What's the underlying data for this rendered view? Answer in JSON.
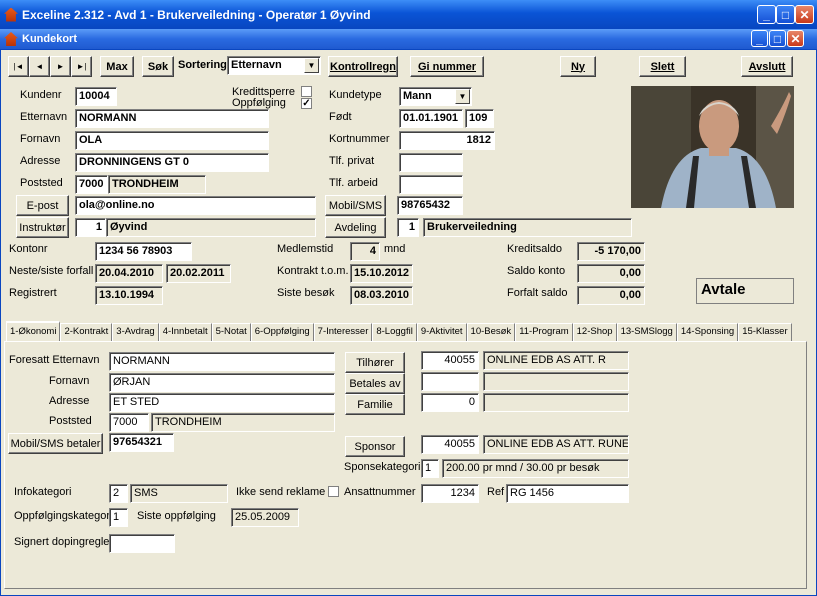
{
  "app": {
    "title": "Exceline 2.312 - Avd 1 - Brukerveiledning - Operatør 1 Øyvind"
  },
  "child": {
    "title": "Kundekort"
  },
  "toolbar": {
    "first": "|◄",
    "prev": "◄",
    "next": "►",
    "last": "►|",
    "max": "Max",
    "search": "Søk",
    "sort_label": "Sortering",
    "sort_value": "Etternavn",
    "kontrollregn": "Kontrollregn",
    "gi_nummer": "Gi nummer",
    "ny": "Ny",
    "slett": "Slett",
    "avslutt": "Avslutt"
  },
  "customer": {
    "kundenr_label": "Kundenr",
    "kundenr": "10004",
    "kredittsperre_label": "Kredittsperre",
    "oppfolging_label": "Oppfølging",
    "kundetype_label": "Kundetype",
    "kundetype": "Mann",
    "etternavn_label": "Etternavn",
    "etternavn": "NORMANN",
    "fodt_label": "Født",
    "fodt": "01.01.1901",
    "alder": "109",
    "fornavn_label": "Fornavn",
    "fornavn": "OLA",
    "kortnummer_label": "Kortnummer",
    "kortnummer": "1812",
    "adresse_label": "Adresse",
    "adresse": "DRONNINGENS GT 0",
    "tlf_privat_label": "Tlf. privat",
    "tlf_privat": "",
    "poststed_label": "Poststed",
    "postnr": "7000",
    "poststed": "TRONDHEIM",
    "tlf_arbeid_label": "Tlf. arbeid",
    "tlf_arbeid": "",
    "epost_btn": "E-post",
    "epost": "ola@online.no",
    "mobil_btn": "Mobil/SMS",
    "mobil": "98765432",
    "instruktor_btn": "Instruktør",
    "instruktor_nr": "1",
    "instruktor": "Øyvind",
    "avdeling_btn": "Avdeling",
    "avdeling_nr": "1",
    "avdeling": "Brukerveiledning"
  },
  "account": {
    "kontonr_label": "Kontonr",
    "kontonr": "1234 56 78903",
    "medlemstid_label": "Medlemstid",
    "medlemstid": "4",
    "mnd": "mnd",
    "kreditsaldo_label": "Kreditsaldo",
    "kreditsaldo": "-5 170,00",
    "forfall_label": "Neste/siste forfall",
    "neste_forfall": "20.04.2010",
    "siste_forfall": "20.02.2011",
    "kontrakt_label": "Kontrakt t.o.m.",
    "kontrakt": "15.10.2012",
    "saldo_label": "Saldo konto",
    "saldo": "0,00",
    "registrert_label": "Registrert",
    "registrert": "13.10.1994",
    "besok_label": "Siste besøk",
    "besok": "08.03.2010",
    "forfalt_label": "Forfalt saldo",
    "forfalt": "0,00",
    "avtale": "Avtale"
  },
  "tabs": [
    "1-Økonomi",
    "2-Kontrakt",
    "3-Avdrag",
    "4-Innbetalt",
    "5-Notat",
    "6-Oppfølging",
    "7-Interesser",
    "8-Loggfil",
    "9-Aktivitet",
    "10-Besøk",
    "11-Program",
    "12-Shop",
    "13-SMSlogg",
    "14-Sponsing",
    "15-Klasser"
  ],
  "economy": {
    "foresatt_label": "Foresatt Etternavn",
    "foresatt_etternavn": "NORMANN",
    "fornavn_label": "Fornavn",
    "fornavn": "ØRJAN",
    "adresse_label": "Adresse",
    "adresse": "ET STED",
    "poststed_label": "Poststed",
    "postnr": "7000",
    "poststed": "TRONDHEIM",
    "mobil_btn": "Mobil/SMS betaler",
    "mobil": "97654321",
    "tilhorer_btn": "Tilhører",
    "tilhorer_nr": "40055",
    "tilhorer": "ONLINE EDB AS ATT. R",
    "betales_btn": "Betales av",
    "betales_nr": "",
    "betales": "",
    "familie_btn": "Familie",
    "familie_nr": "0",
    "familie": "",
    "sponsor_btn": "Sponsor",
    "sponsor_nr": "40055",
    "sponsor": "ONLINE EDB AS ATT. RUNE",
    "sponsekategori_label": "Sponsekategori",
    "sponsekategori_nr": "1",
    "sponsekategori": "200.00 pr mnd / 30.00 pr besøk",
    "infokategori_label": "Infokategori",
    "infokategori_nr": "2",
    "infokategori": "SMS",
    "reklame_label": "Ikke send reklame",
    "ansattnr_label": "Ansattnummer",
    "ansattnr": "1234",
    "ref_label": "Ref",
    "ref": "RG 1456",
    "oppfolgingskat_label": "Oppfølgingskategori",
    "oppfolgingskat": "1",
    "siste_oppfolging_label": "Siste oppfølging",
    "siste_oppfolging": "25.05.2009",
    "dopingregler_label": "Signert dopingregler",
    "dopingregler": ""
  },
  "colors": {
    "titlebar": "#0a54d6",
    "window": "#ece9d8"
  }
}
